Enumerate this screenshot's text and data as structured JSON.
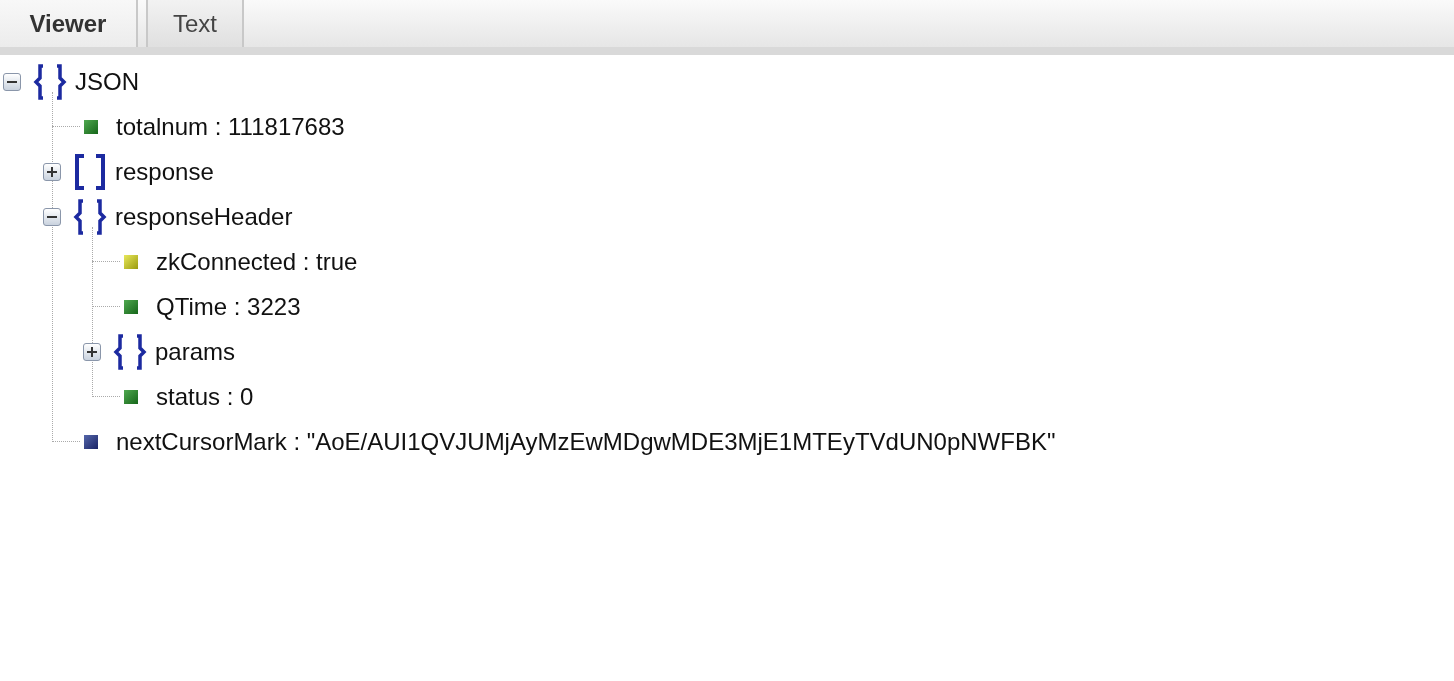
{
  "tabs": [
    {
      "label": "Viewer",
      "selected": true
    },
    {
      "label": "Text",
      "selected": false
    }
  ],
  "tree": {
    "kind": "object",
    "text": "JSON",
    "expanded": true,
    "children": [
      {
        "kind": "number",
        "text": "totalnum : 111817683"
      },
      {
        "kind": "array",
        "text": "response",
        "expanded": false
      },
      {
        "kind": "object",
        "text": "responseHeader",
        "expanded": true,
        "children": [
          {
            "kind": "boolean",
            "text": "zkConnected : true"
          },
          {
            "kind": "number",
            "text": "QTime : 3223"
          },
          {
            "kind": "object",
            "text": "params",
            "expanded": false
          },
          {
            "kind": "number",
            "text": "status : 0"
          }
        ]
      },
      {
        "kind": "string",
        "text": "nextCursorMark : \"AoE/AUI1QVJUMjAyMzEwMDgwMDE3MjE1MTEyTVdUN0pNWFBK\""
      }
    ]
  }
}
